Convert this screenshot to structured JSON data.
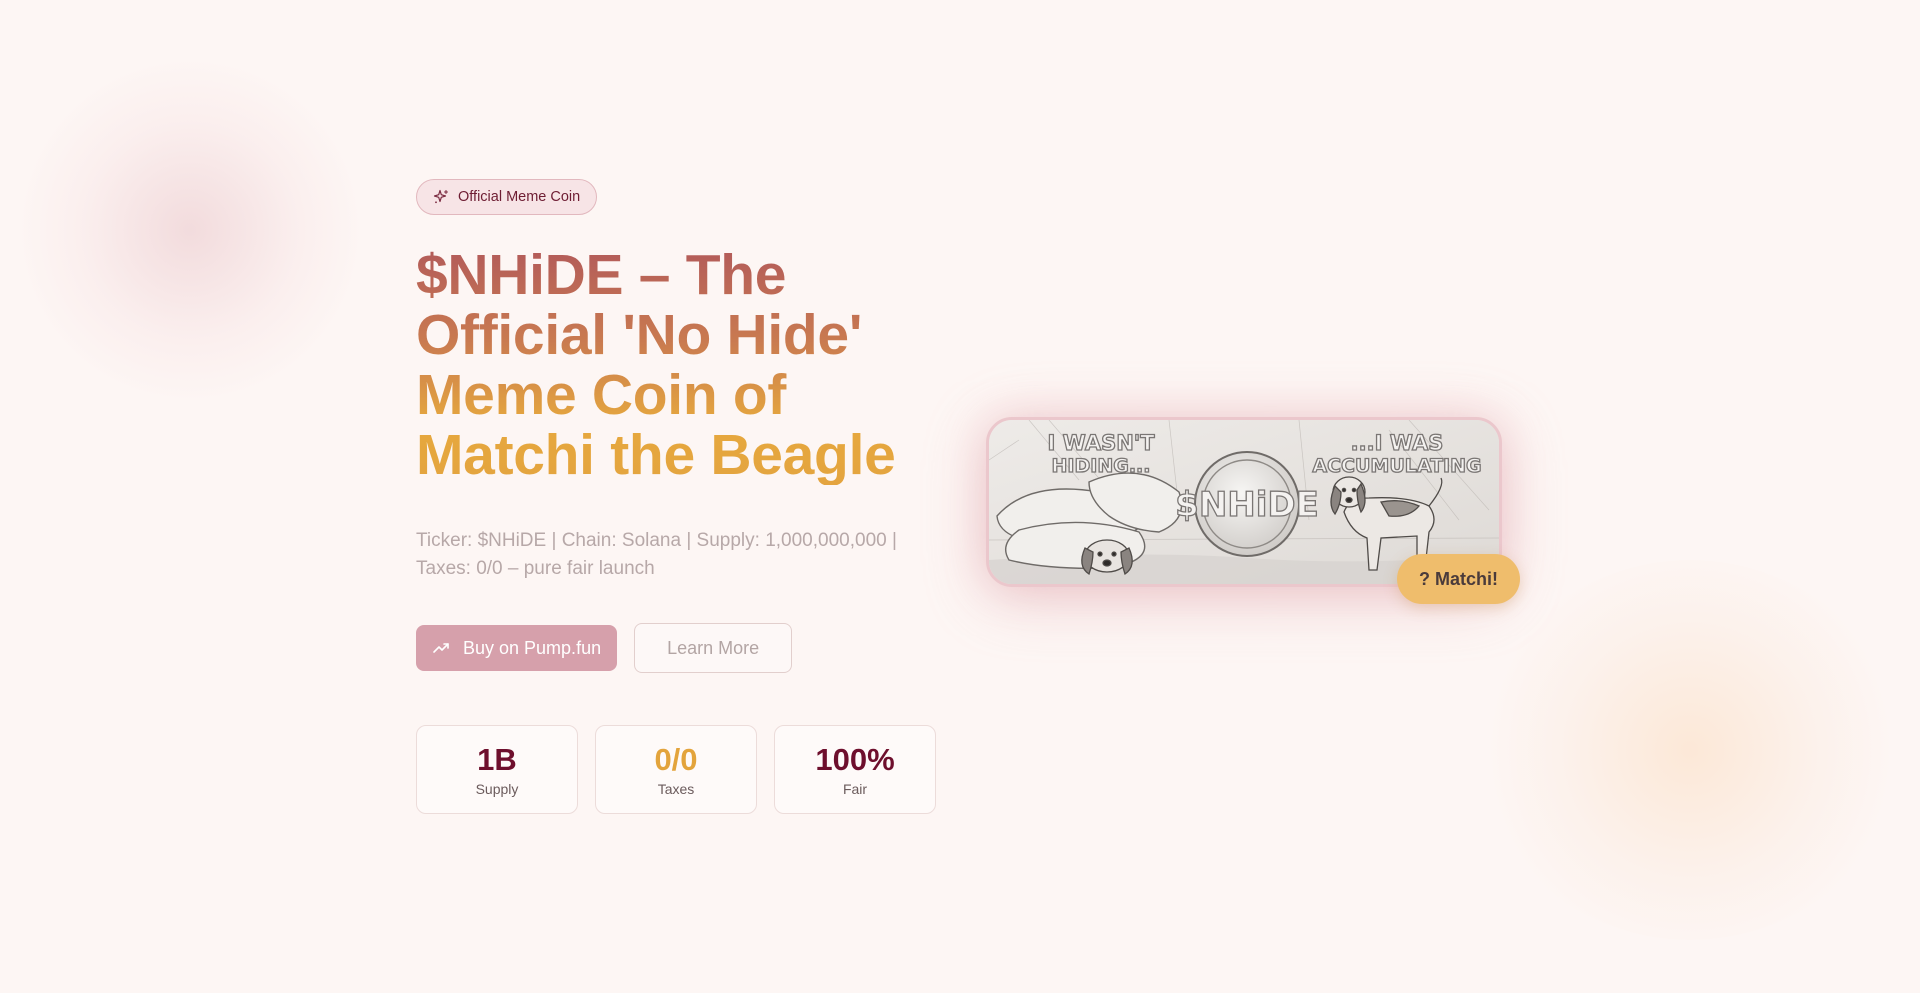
{
  "badge": {
    "label": "Official Meme Coin",
    "icon": "sparkles-icon"
  },
  "headline": {
    "line1": "$NHiDE – The",
    "line2": "Official 'No Hide'",
    "line3": "Meme Coin of",
    "line4": "Matchi the Beagle"
  },
  "subtitle": "Ticker: $NHiDE | Chain: Solana | Supply: 1,000,000,000 | Taxes: 0/0 – pure fair launch",
  "buttons": {
    "buy_label": "Buy on Pump.fun",
    "buy_icon": "trending-up-icon",
    "learn_label": "Learn More"
  },
  "stats": [
    {
      "value": "1B",
      "label": "Supply",
      "color": "#6e0f2d"
    },
    {
      "value": "0/0",
      "label": "Taxes",
      "color": "#e3a43c"
    },
    {
      "value": "100%",
      "label": "Fair",
      "color": "#6e0f2d"
    }
  ],
  "hero_image": {
    "text_left": "I WASN'T HIDING...",
    "text_left_1": "I WASN'T",
    "text_left_2": "HIDING...",
    "text_right_1": "...I WAS",
    "text_right_2": "ACCUMULATING",
    "coin_text": "$NHiDE"
  },
  "matchi_pill": "? Matchi!",
  "colors": {
    "background": "#fdf6f4",
    "accent_maroon": "#6e0f2d",
    "accent_gold": "#e3a43c",
    "buy_button": "#d6a0ab"
  }
}
